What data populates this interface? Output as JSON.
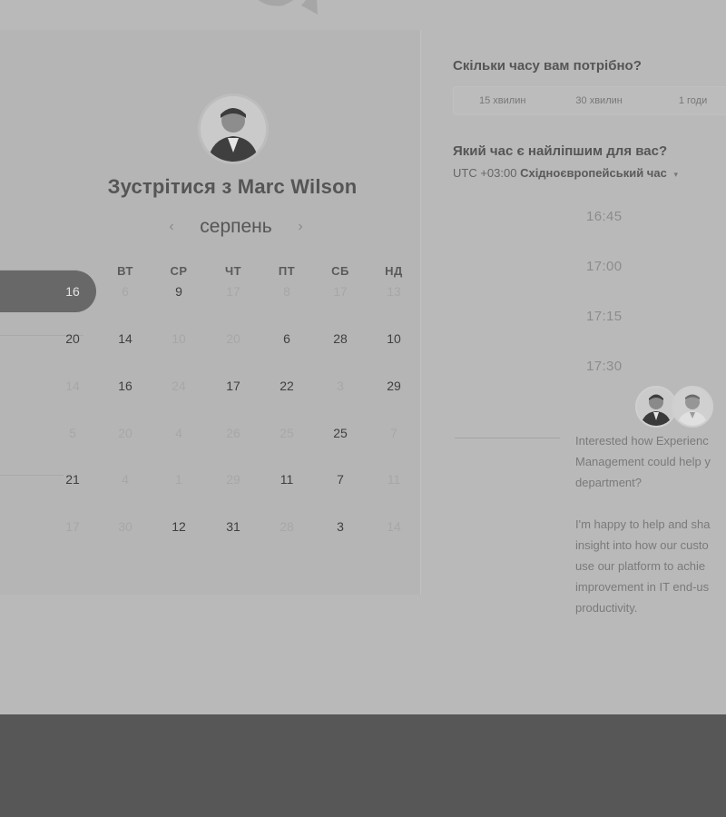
{
  "calendar": {
    "title": "Зустрітися з Marc Wilson",
    "month": "серпень",
    "prev_icon": "‹",
    "next_icon": "›",
    "weekdays": [
      "ВТ",
      "СР",
      "ЧТ",
      "ПТ",
      "СБ",
      "НД"
    ],
    "rows": [
      [
        {
          "t": "16",
          "s": "sel"
        },
        {
          "t": "6",
          "s": "dim"
        },
        {
          "t": "9",
          "s": "act"
        },
        {
          "t": "17",
          "s": "dim"
        },
        {
          "t": "8",
          "s": "dim"
        },
        {
          "t": "17",
          "s": "dim"
        },
        {
          "t": "13",
          "s": "dim"
        }
      ],
      [
        {
          "t": "20",
          "s": "act"
        },
        {
          "t": "14",
          "s": "act"
        },
        {
          "t": "10",
          "s": "dim"
        },
        {
          "t": "20",
          "s": "dim"
        },
        {
          "t": "6",
          "s": "act"
        },
        {
          "t": "28",
          "s": "act"
        },
        {
          "t": "10",
          "s": "act"
        }
      ],
      [
        {
          "t": "14",
          "s": "dim"
        },
        {
          "t": "16",
          "s": "act"
        },
        {
          "t": "24",
          "s": "dim"
        },
        {
          "t": "17",
          "s": "act"
        },
        {
          "t": "22",
          "s": "act"
        },
        {
          "t": "3",
          "s": "dim"
        },
        {
          "t": "29",
          "s": "act"
        }
      ],
      [
        {
          "t": "5",
          "s": "dim"
        },
        {
          "t": "20",
          "s": "dim"
        },
        {
          "t": "4",
          "s": "dim"
        },
        {
          "t": "26",
          "s": "dim"
        },
        {
          "t": "25",
          "s": "dim"
        },
        {
          "t": "25",
          "s": "act"
        },
        {
          "t": "7",
          "s": "dim"
        }
      ],
      [
        {
          "t": "21",
          "s": "act"
        },
        {
          "t": "4",
          "s": "dim"
        },
        {
          "t": "1",
          "s": "dim"
        },
        {
          "t": "29",
          "s": "dim"
        },
        {
          "t": "11",
          "s": "act"
        },
        {
          "t": "7",
          "s": "act"
        },
        {
          "t": "11",
          "s": "dim"
        }
      ],
      [
        {
          "t": "17",
          "s": "dim"
        },
        {
          "t": "30",
          "s": "dim"
        },
        {
          "t": "12",
          "s": "act"
        },
        {
          "t": "31",
          "s": "act"
        },
        {
          "t": "28",
          "s": "dim"
        },
        {
          "t": "3",
          "s": "act"
        },
        {
          "t": "14",
          "s": "dim"
        }
      ]
    ]
  },
  "duration": {
    "question": "Скільки часу вам потрібно?",
    "options": [
      "15 хвилин",
      "30 хвилин",
      "1 годи"
    ]
  },
  "time": {
    "question": "Який час є найліпшим для вас?",
    "tz_offset": "UTC +03:00",
    "tz_name": "Східноєвропейський час",
    "tz_caret": "▾",
    "slots": [
      "16:45",
      "17:00",
      "17:15",
      "17:30"
    ]
  },
  "message": {
    "lines": [
      "Interested how Experienc",
      "Management could help y",
      "department?",
      "",
      "I'm happy to help and sha",
      "insight into how our custo",
      "use our platform to achie",
      "improvement in IT end-us",
      "productivity."
    ]
  },
  "colors": {
    "overlay_background": "#b9b9b9",
    "footer": "#575757",
    "selected_day": "#686868"
  },
  "icons": {
    "logo": "logo-partial",
    "avatar": "avatar-icon"
  }
}
